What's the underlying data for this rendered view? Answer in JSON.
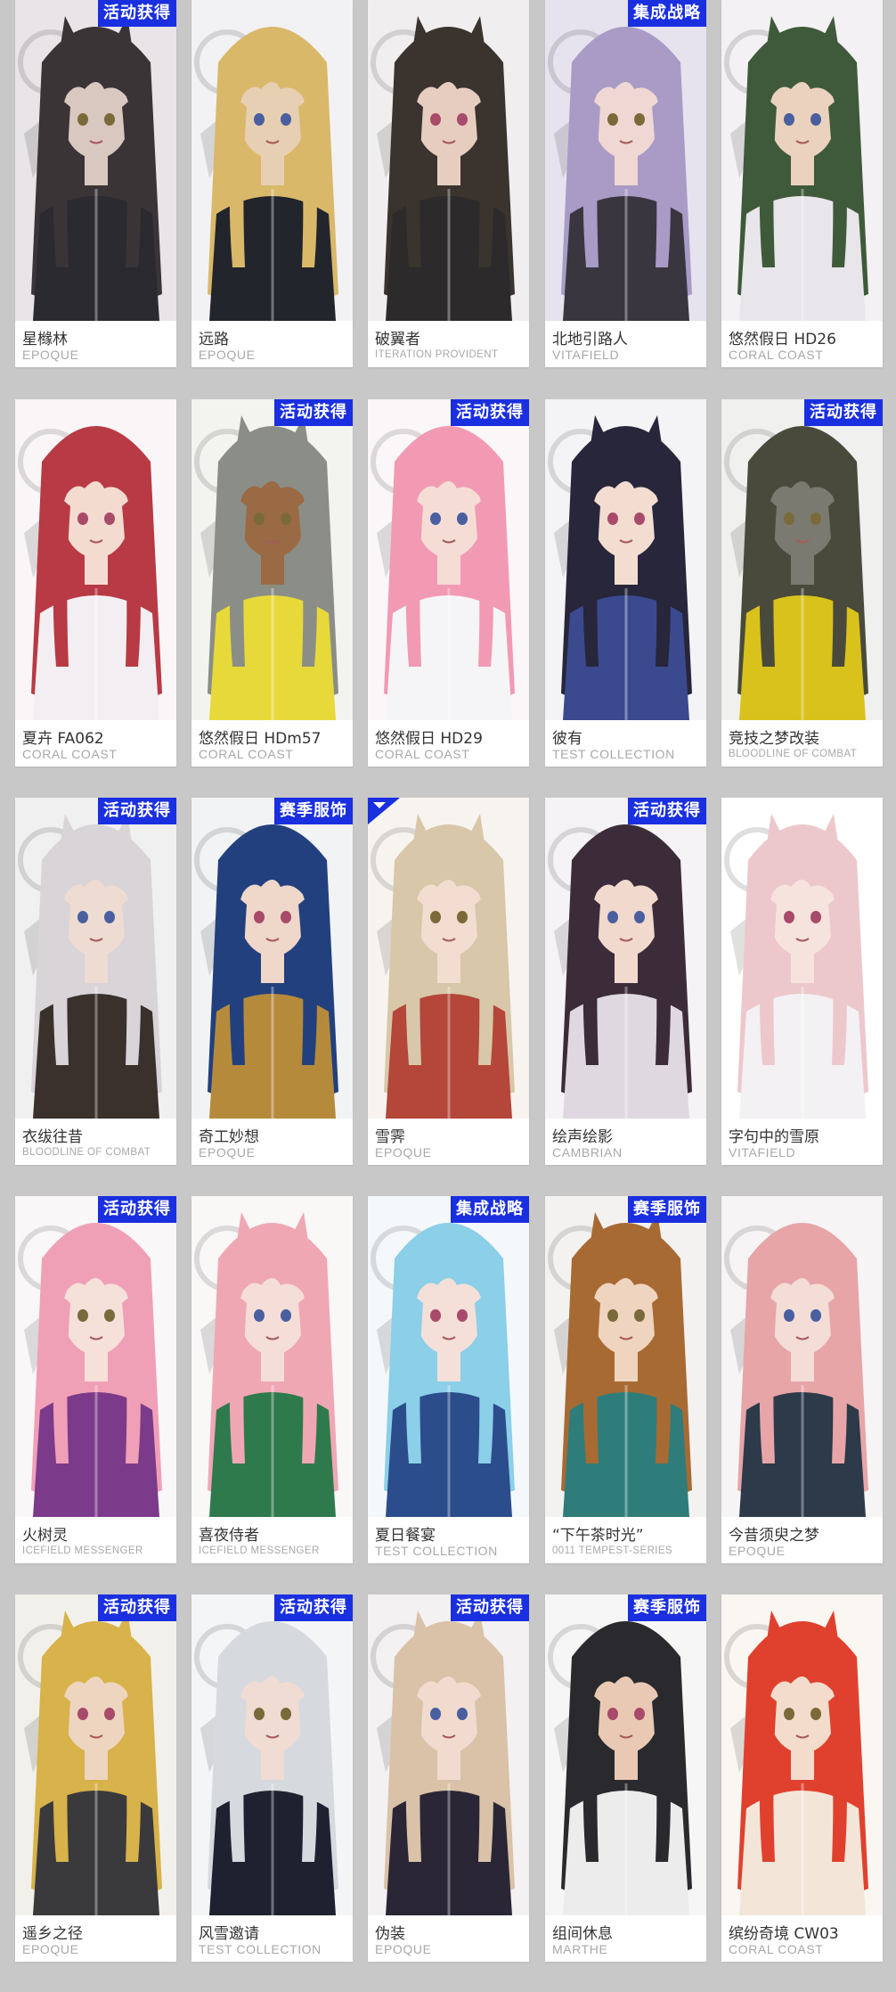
{
  "colors": {
    "background": "#c8c8c8",
    "badge_blue": "#1a2fe0",
    "name_text": "#333333",
    "brand_text": "#a8a8a8"
  },
  "cards": [
    {
      "name": "星橼林",
      "brand": "EPOQUE",
      "badge": "活动获得",
      "palette": [
        "#3b3437",
        "#2a2a30",
        "#e8e4e8",
        "#d9c8bf"
      ]
    },
    {
      "name": "远路",
      "brand": "EPOQUE",
      "badge": "",
      "palette": [
        "#d9b86a",
        "#22252b",
        "#f2f2f4",
        "#e7cfb3"
      ]
    },
    {
      "name": "破翼者",
      "brand": "ITERATION PROVIDENT",
      "badge": "",
      "palette": [
        "#3a332e",
        "#2c2a2a",
        "#f0eeee",
        "#e6cdbf"
      ]
    },
    {
      "name": "北地引路人",
      "brand": "VITAFIELD",
      "badge": "集成战略",
      "palette": [
        "#a99bc6",
        "#3a3640",
        "#e6e3ee",
        "#efd8d3"
      ]
    },
    {
      "name": "悠然假日 HD26",
      "brand": "CORAL COAST",
      "badge": "",
      "palette": [
        "#3f5a3a",
        "#e8e6ea",
        "#f3f1f4",
        "#ead2bf"
      ]
    },
    {
      "name": "夏卉 FA062",
      "brand": "CORAL COAST",
      "badge": "",
      "palette": [
        "#b83a45",
        "#f3eef2",
        "#faf6f8",
        "#f3dbd0"
      ]
    },
    {
      "name": "悠然假日 HDm57",
      "brand": "CORAL COAST",
      "badge": "活动获得",
      "palette": [
        "#8b8e86",
        "#e8d93a",
        "#f3f3f0",
        "#9a6a45"
      ]
    },
    {
      "name": "悠然假日 HD29",
      "brand": "CORAL COAST",
      "badge": "活动获得",
      "palette": [
        "#f29ab3",
        "#f5f5f7",
        "#fbf7f9",
        "#f5ddd6"
      ]
    },
    {
      "name": "彼有",
      "brand": "TEST COLLECTION",
      "badge": "",
      "palette": [
        "#27263a",
        "#3b4a8e",
        "#f4f4f6",
        "#f3dcd0"
      ]
    },
    {
      "name": "竞技之梦改装",
      "brand": "BLOODLINE OF COMBAT",
      "badge": "活动获得",
      "palette": [
        "#4a4a3c",
        "#d9c21c",
        "#f0f0ee",
        "#7a7a70"
      ]
    },
    {
      "name": "衣绂往昔",
      "brand": "BLOODLINE OF COMBAT",
      "badge": "活动获得",
      "palette": [
        "#d8d4d8",
        "#3a302c",
        "#f1f0f1",
        "#eedcd2"
      ]
    },
    {
      "name": "奇工妙想",
      "brand": "EPOQUE",
      "badge": "赛季服饰",
      "palette": [
        "#23407e",
        "#b58b3b",
        "#f2f3f5",
        "#efd7c9"
      ]
    },
    {
      "name": "雪霁",
      "brand": "EPOQUE",
      "badge": "",
      "palette": [
        "#d8c7a8",
        "#b4463a",
        "#f7f4f0",
        "#f2ddd0"
      ]
    },
    {
      "name": "绘声绘影",
      "brand": "CAMBRIAN",
      "badge": "活动获得",
      "palette": [
        "#3c2c3a",
        "#dfd8e0",
        "#f5f3f5",
        "#f1d9cd"
      ]
    },
    {
      "name": "字句中的雪原",
      "brand": "VITAFIELD",
      "badge": "",
      "palette": [
        "#ecc8cc",
        "#f3f1f3",
        "#ffffff",
        "#f6e3dd"
      ]
    },
    {
      "name": "火树灵",
      "brand": "ICEFIELD MESSENGER",
      "badge": "活动获得",
      "palette": [
        "#f0a0b6",
        "#7c3a8a",
        "#faf7f9",
        "#f6e0da"
      ]
    },
    {
      "name": "喜夜侍者",
      "brand": "ICEFIELD MESSENGER",
      "badge": "",
      "palette": [
        "#f0a7b4",
        "#2f7a4c",
        "#faf7f7",
        "#f5ded7"
      ]
    },
    {
      "name": "夏日餐宴",
      "brand": "TEST COLLECTION",
      "badge": "集成战略",
      "palette": [
        "#8bcfe8",
        "#2b4d8c",
        "#f5f8fb",
        "#f4e0d8"
      ]
    },
    {
      "name": "“下午茶时光”",
      "brand": "0011 TEMPEST-SERIES",
      "badge": "赛季服饰",
      "palette": [
        "#a86a33",
        "#2e7d7a",
        "#f3f2f0",
        "#efd4c0"
      ]
    },
    {
      "name": "今昔须臾之梦",
      "brand": "EPOQUE",
      "badge": "",
      "palette": [
        "#e7a5a8",
        "#2c3a4a",
        "#f6f4f5",
        "#f3ddd6"
      ]
    },
    {
      "name": "遥乡之径",
      "brand": "EPOQUE",
      "badge": "活动获得",
      "palette": [
        "#d8b24a",
        "#3a3a3c",
        "#f2f0ea",
        "#edd5c0"
      ]
    },
    {
      "name": "风雪邀请",
      "brand": "TEST COLLECTION",
      "badge": "活动获得",
      "palette": [
        "#d6d9de",
        "#1e2230",
        "#f4f5f7",
        "#f0dcd2"
      ]
    },
    {
      "name": "伪装",
      "brand": "EPOQUE",
      "badge": "活动获得",
      "palette": [
        "#d9c2a8",
        "#2a2636",
        "#f3f1f1",
        "#f1dbcf"
      ]
    },
    {
      "name": "组间休息",
      "brand": "MARTHE",
      "badge": "赛季服饰",
      "palette": [
        "#2a2a2e",
        "#ececec",
        "#f6f6f6",
        "#e9c9b3"
      ]
    },
    {
      "name": "缤纷奇境 CW03",
      "brand": "CORAL COAST",
      "badge": "",
      "palette": [
        "#e0412e",
        "#f3e6d8",
        "#faf6f2",
        "#f4dccd"
      ]
    }
  ]
}
